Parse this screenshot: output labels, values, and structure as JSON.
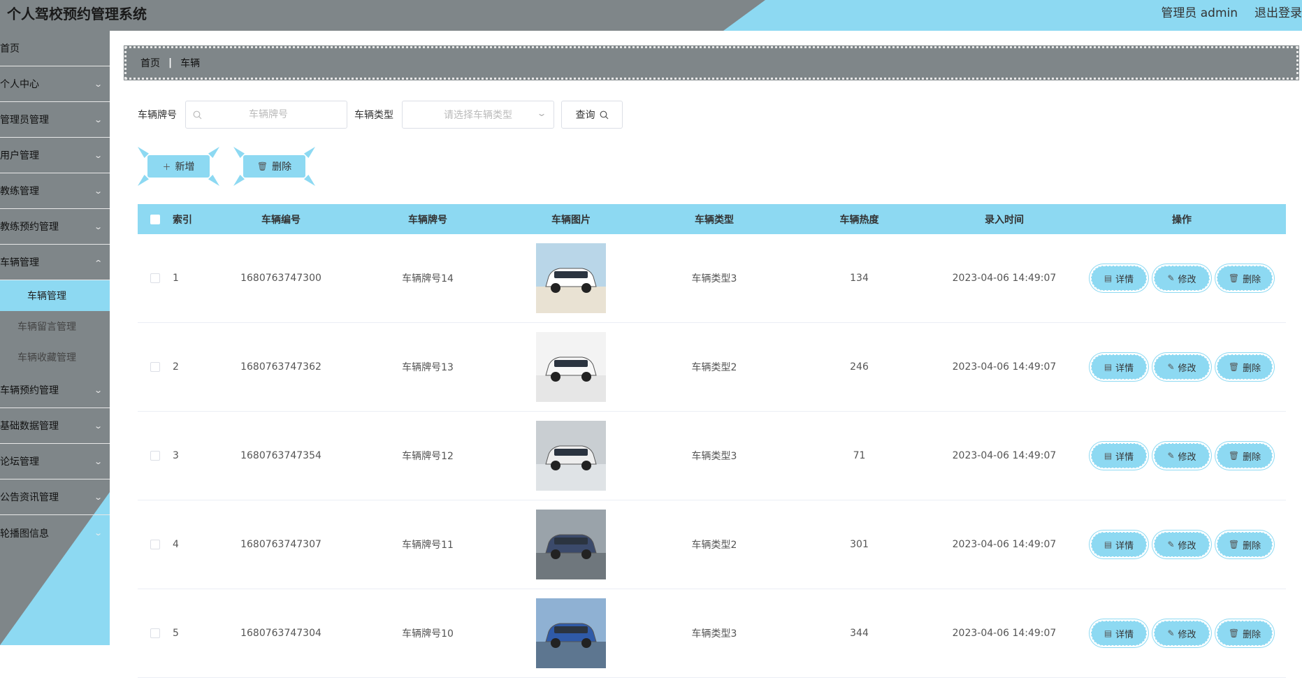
{
  "app": {
    "title": "个人驾校预约管理系统",
    "admin_label": "管理员 admin",
    "logout_label": "退出登录"
  },
  "sidebar": {
    "items": [
      {
        "label": "首页",
        "has_children": false
      },
      {
        "label": "个人中心",
        "has_children": true
      },
      {
        "label": "管理员管理",
        "has_children": true
      },
      {
        "label": "用户管理",
        "has_children": true
      },
      {
        "label": "教练管理",
        "has_children": true
      },
      {
        "label": "教练预约管理",
        "has_children": true
      },
      {
        "label": "车辆管理",
        "has_children": true,
        "expanded": true
      }
    ],
    "sub_items": [
      {
        "label": "车辆管理",
        "active": true
      },
      {
        "label": "车辆留言管理",
        "active": false
      },
      {
        "label": "车辆收藏管理",
        "active": false
      }
    ],
    "items_after": [
      {
        "label": "车辆预约管理"
      },
      {
        "label": "基础数据管理"
      },
      {
        "label": "论坛管理"
      },
      {
        "label": "公告资讯管理"
      },
      {
        "label": "轮播图信息"
      }
    ]
  },
  "breadcrumb": {
    "home": "首页",
    "separator": "|",
    "current": "车辆"
  },
  "filter": {
    "plate_label": "车辆牌号",
    "plate_placeholder": "车辆牌号",
    "type_label": "车辆类型",
    "type_placeholder": "请选择车辆类型",
    "query_label": "查询"
  },
  "actions": {
    "add_label": "新增",
    "delete_label": "删除"
  },
  "table": {
    "headers": {
      "index": "索引",
      "number": "车辆编号",
      "plate": "车辆牌号",
      "image": "车辆图片",
      "type": "车辆类型",
      "heat": "车辆热度",
      "time": "录入时间",
      "ops": "操作"
    },
    "op_labels": {
      "detail": "详情",
      "edit": "修改",
      "delete": "删除"
    },
    "rows": [
      {
        "index": "1",
        "number": "1680763747300",
        "plate": "车辆牌号14",
        "type": "车辆类型3",
        "heat": "134",
        "time": "2023-04-06 14:49:07"
      },
      {
        "index": "2",
        "number": "1680763747362",
        "plate": "车辆牌号13",
        "type": "车辆类型2",
        "heat": "246",
        "time": "2023-04-06 14:49:07"
      },
      {
        "index": "3",
        "number": "1680763747354",
        "plate": "车辆牌号12",
        "type": "车辆类型3",
        "heat": "71",
        "time": "2023-04-06 14:49:07"
      },
      {
        "index": "4",
        "number": "1680763747307",
        "plate": "车辆牌号11",
        "type": "车辆类型2",
        "heat": "301",
        "time": "2023-04-06 14:49:07"
      },
      {
        "index": "5",
        "number": "1680763747304",
        "plate": "车辆牌号10",
        "type": "车辆类型3",
        "heat": "344",
        "time": "2023-04-06 14:49:07"
      }
    ]
  },
  "colors": {
    "accent": "#8dd9f2",
    "gray": "#7f8689"
  }
}
